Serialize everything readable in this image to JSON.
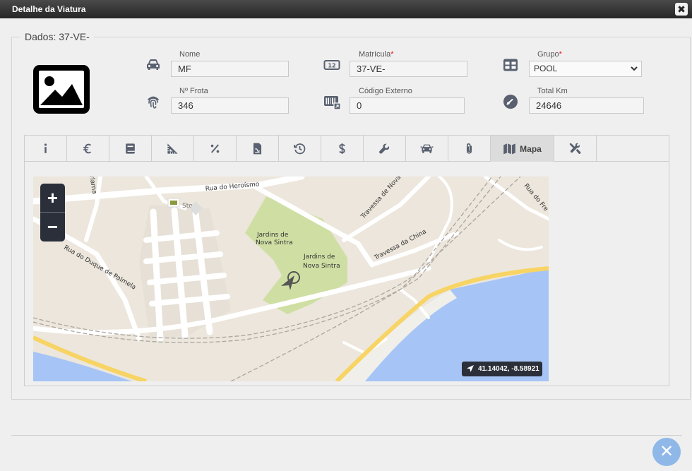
{
  "window": {
    "title": "Detalhe da Viatura",
    "close_label": "✖"
  },
  "dados": {
    "legend_label": "Dados:",
    "legend_value": "37-VE-"
  },
  "fields": {
    "nome": {
      "label": "Nome",
      "value": "MF",
      "icon": "car-icon"
    },
    "matricula": {
      "label": "Matrícula",
      "required": "*",
      "value": "37-VE-",
      "icon": "license-plate-icon"
    },
    "grupo": {
      "label": "Grupo",
      "required": "*",
      "value": "POOL",
      "icon": "grid-icon"
    },
    "frota": {
      "label": "Nº Frota",
      "value": "346",
      "icon": "fingerprint-icon"
    },
    "codigo_externo": {
      "label": "Código Externo",
      "value": "0",
      "icon": "barcode-icon"
    },
    "total_km": {
      "label": "Total Km",
      "value": "24646",
      "icon": "speedometer-icon"
    }
  },
  "tabs": [
    {
      "icon": "info-icon"
    },
    {
      "icon": "euro-icon"
    },
    {
      "icon": "book-icon"
    },
    {
      "icon": "ruler-triangle-icon"
    },
    {
      "icon": "percent-icon"
    },
    {
      "icon": "document-icon"
    },
    {
      "icon": "history-icon"
    },
    {
      "icon": "dollar-icon"
    },
    {
      "icon": "wrench-icon"
    },
    {
      "icon": "car-front-icon"
    },
    {
      "icon": "paperclip-icon"
    },
    {
      "icon": "map-icon",
      "label": "Mapa",
      "active": true
    },
    {
      "icon": "tools-icon"
    }
  ],
  "map": {
    "zoom_in": "+",
    "zoom_out": "−",
    "coordinates": "41.14042, -8.58921",
    "labels": {
      "rua_heroismo": "Rua do Heroísmo",
      "stop": "Stop",
      "jardins1_line1": "Jardins de",
      "jardins1_line2": "Nova Sintra",
      "jardins2_line1": "Jardins de",
      "jardins2_line2": "Nova Sintra",
      "trav_nova_sintra": "Travessa de Nova Sintra",
      "trav_china": "Travessa da China",
      "rua_duque": "Rua do Duque de Palmela",
      "rua_fre": "Rua do Fre",
      "rua_left": "rlarna"
    }
  },
  "footer": {
    "close_label": "✕"
  },
  "colors": {
    "titlebar": "#262626",
    "fab": "#8fb8e8",
    "required": "#e02020",
    "icon": "#59606f"
  }
}
